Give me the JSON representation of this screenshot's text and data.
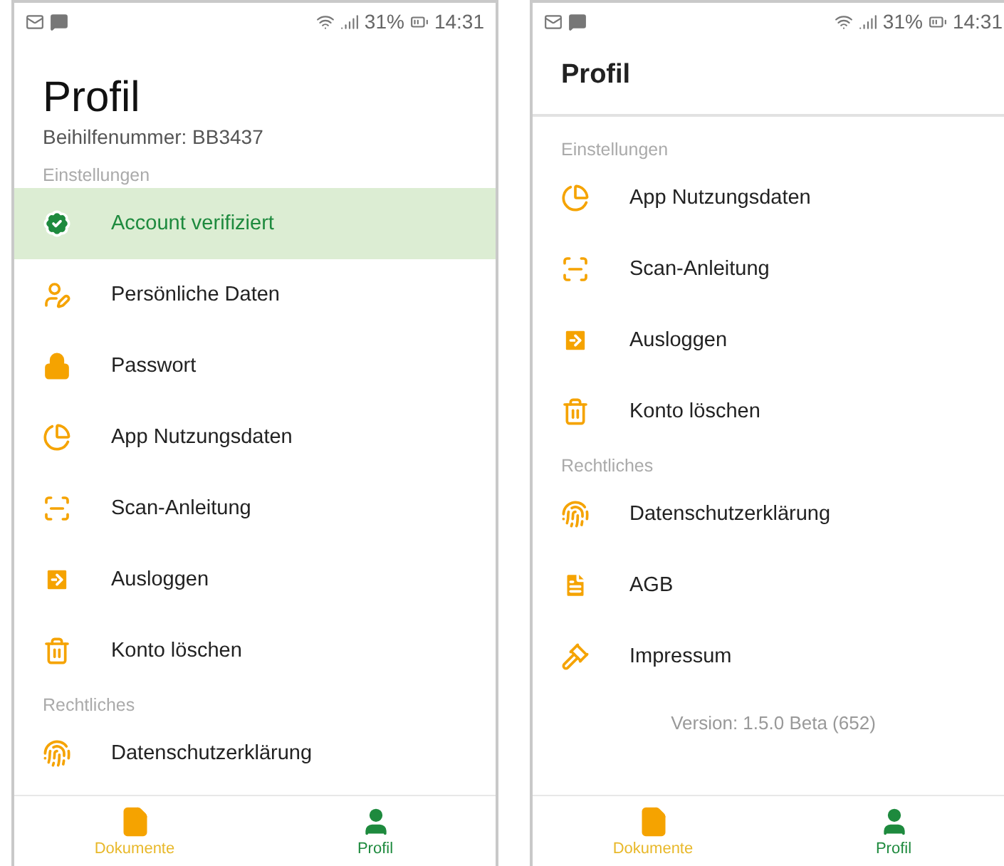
{
  "screens": [
    {
      "status_bar": {
        "battery": "31%",
        "time": "14:31"
      },
      "header": {
        "kind": "large",
        "title": "Profil"
      },
      "subtitle": "Beihilfenummer: BB3437",
      "sections": [
        {
          "title": "Einstellungen",
          "items": [
            {
              "label": "Account verifiziert",
              "kind": "verified",
              "highlighted": true
            },
            {
              "label": "Persönliche Daten",
              "kind": "personal",
              "highlighted": false
            },
            {
              "label": "Passwort",
              "kind": "password",
              "highlighted": false
            },
            {
              "label": "App Nutzungsdaten",
              "kind": "usage",
              "highlighted": false
            },
            {
              "label": "Scan-Anleitung",
              "kind": "scan",
              "highlighted": false
            },
            {
              "label": "Ausloggen",
              "kind": "logout",
              "highlighted": false
            },
            {
              "label": "Konto löschen",
              "kind": "delete",
              "highlighted": false
            }
          ]
        },
        {
          "title": "Rechtliches",
          "items": [
            {
              "label": "Datenschutzerklärung",
              "kind": "privacy",
              "highlighted": false
            }
          ]
        }
      ],
      "nav": [
        {
          "label": "Dokumente",
          "kind": "documents",
          "selected": false
        },
        {
          "label": "Profil",
          "kind": "profile",
          "selected": true
        }
      ]
    },
    {
      "status_bar": {
        "battery": "31%",
        "time": "14:31"
      },
      "header": {
        "kind": "bar",
        "title": "Profil"
      },
      "sections": [
        {
          "title": "Einstellungen",
          "items": [
            {
              "label": "App Nutzungsdaten",
              "kind": "usage",
              "highlighted": false
            },
            {
              "label": "Scan-Anleitung",
              "kind": "scan",
              "highlighted": false
            },
            {
              "label": "Ausloggen",
              "kind": "logout",
              "highlighted": false
            },
            {
              "label": "Konto löschen",
              "kind": "delete",
              "highlighted": false
            }
          ]
        },
        {
          "title": "Rechtliches",
          "items": [
            {
              "label": "Datenschutzerklärung",
              "kind": "privacy",
              "highlighted": false
            },
            {
              "label": "AGB",
              "kind": "terms",
              "highlighted": false
            },
            {
              "label": "Impressum",
              "kind": "imprint",
              "highlighted": false
            }
          ]
        }
      ],
      "version": "Version: 1.5.0 Beta (652)",
      "nav": [
        {
          "label": "Dokumente",
          "kind": "documents",
          "selected": false
        },
        {
          "label": "Profil",
          "kind": "profile",
          "selected": true
        }
      ]
    }
  ]
}
